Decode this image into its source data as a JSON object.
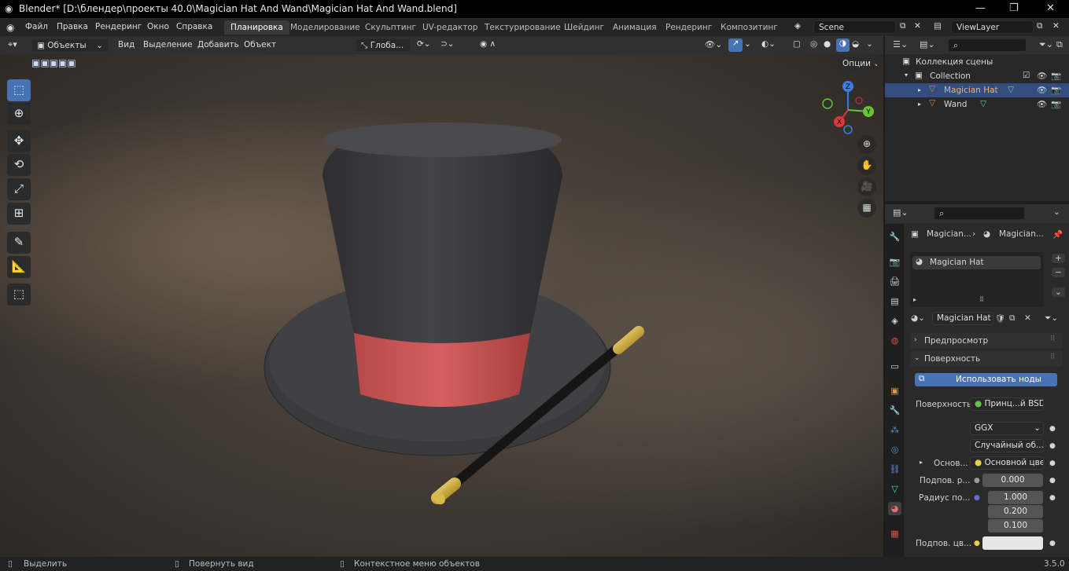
{
  "window": {
    "title": "Blender* [D:\\блендер\\проекты 40.0\\Magician Hat And Wand\\Magician Hat And Wand.blend]",
    "minimize": "—",
    "maximize": "❐",
    "close": "✕"
  },
  "menu": {
    "items": [
      "Файл",
      "Правка",
      "Рендеринг",
      "Окно",
      "Справка"
    ]
  },
  "workspaces": [
    "Планировка",
    "Моделирование",
    "Скульптинг",
    "UV-редактор",
    "Текстурирование",
    "Шейдинг",
    "Анимация",
    "Рендеринг",
    "Композитинг"
  ],
  "scene": {
    "name": "Scene",
    "view_layer": "ViewLayer"
  },
  "viewport": {
    "mode": "Объекты",
    "menus": [
      "Вид",
      "Выделение",
      "Добавить",
      "Объект"
    ],
    "transform": "Глоба...",
    "options": "Опции"
  },
  "gizmo": {
    "x": "X",
    "y": "Y",
    "z": "Z"
  },
  "outliner": {
    "scene_collection": "Коллекция сцены",
    "collection": "Collection",
    "objects": [
      "Magician Hat",
      "Wand"
    ]
  },
  "properties": {
    "breadcrumb": [
      "Magician...",
      "Magician..."
    ],
    "slot": "Magician Hat",
    "material": "Magician Hat",
    "panels": {
      "preview": "Предпросмотр",
      "surface": "Поверхность"
    },
    "use_nodes": "Использовать ноды",
    "surface_label": "Поверхность",
    "surface_value": "Принц...й BSDF",
    "distribution": "GGX",
    "subsurface_method": "Случайный об...",
    "base_label": "Основ...",
    "base_value": "Основной цвет",
    "subsurface_label": "Подпов. р...",
    "subsurface_value": "0.000",
    "radius_label": "Радиус по...",
    "radius_values": [
      "1.000",
      "0.200",
      "0.100"
    ],
    "subsurface_color_label": "Подпов. цв..."
  },
  "status": {
    "left": "Выделить",
    "middle": "Повернуть вид",
    "right": "Контекстное меню объектов",
    "version": "3.5.0"
  },
  "colors": {
    "accent": "#4772b3",
    "selected_row": "#334d80",
    "hat": "#3b3b3d",
    "band": "#c25050",
    "gold": "#c9a227"
  }
}
